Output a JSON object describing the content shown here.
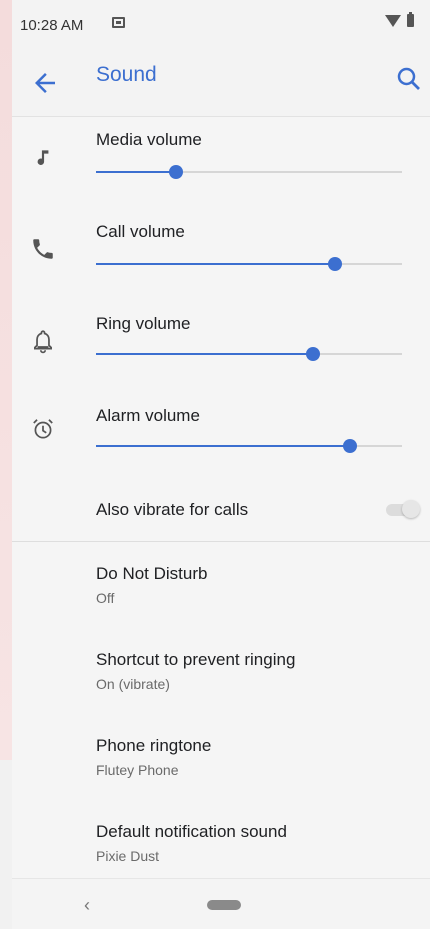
{
  "status_bar": {
    "time": "10:28 AM"
  },
  "app_bar": {
    "title": "Sound"
  },
  "volumes": {
    "media": {
      "label": "Media volume",
      "level_percent": 26
    },
    "call": {
      "label": "Call volume",
      "level_percent": 78
    },
    "ring": {
      "label": "Ring volume",
      "level_percent": 71
    },
    "alarm": {
      "label": "Alarm volume",
      "level_percent": 83
    }
  },
  "vibrate_for_calls": {
    "label": "Also vibrate for calls",
    "enabled": false
  },
  "settings": {
    "do_not_disturb": {
      "title": "Do Not Disturb",
      "value": "Off"
    },
    "prevent_ringing": {
      "title": "Shortcut to prevent ringing",
      "value": "On (vibrate)"
    },
    "phone_ringtone": {
      "title": "Phone ringtone",
      "value": "Flutey Phone"
    },
    "notification_sound": {
      "title": "Default notification sound",
      "value": "Pixie Dust"
    }
  },
  "colors": {
    "accent": "#3c6fd0",
    "track": "#d6d6d6",
    "text_secondary": "#6a6a6a"
  },
  "icons": [
    "music-note-icon",
    "phone-icon",
    "bell-icon",
    "alarm-clock-icon",
    "back-arrow-icon",
    "search-icon"
  ]
}
